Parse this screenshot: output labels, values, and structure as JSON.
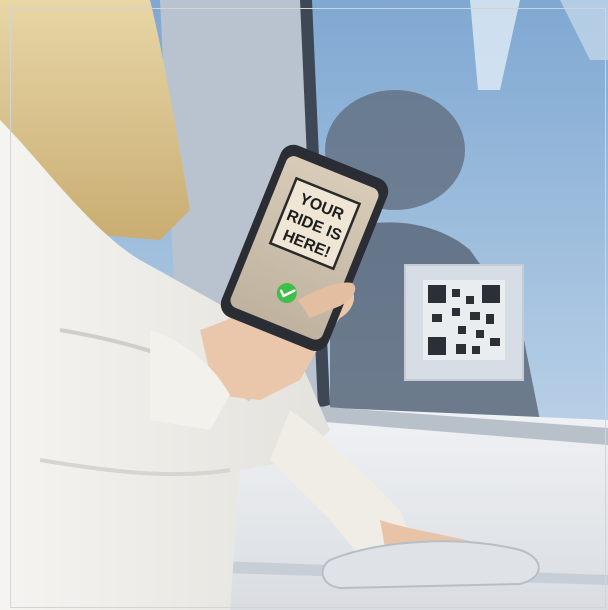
{
  "photo": {
    "subject": "woman-scanning-qr-code-on-car-window"
  },
  "phone": {
    "sign_line_1": "YOUR",
    "sign_line_2": "RIDE IS",
    "sign_line_3": "HERE!",
    "confirm_icon": "check-circle-icon",
    "confirm_color": "#3fbf4a"
  },
  "car": {
    "qr_sticker_icon": "qr-code-icon",
    "body_color": "#e3e6ea"
  }
}
